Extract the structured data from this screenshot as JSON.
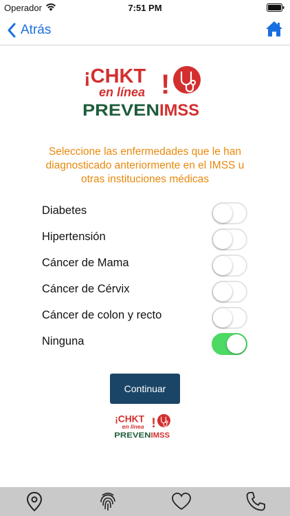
{
  "status_bar": {
    "carrier": "Operador",
    "time": "7:51 PM"
  },
  "nav": {
    "back_label": "Atrás"
  },
  "logo": {
    "line1": "¡CHKT",
    "line2": "en línea",
    "exclamation": "!",
    "brand_prefix": "PREVEN",
    "brand_suffix": "IMSS"
  },
  "instruction": "Seleccione las enfermedades que le han diagnosticado anteriormente en el IMSS u otras instituciones médicas",
  "diseases": [
    {
      "label": "Diabetes",
      "checked": false
    },
    {
      "label": "Hipertensión",
      "checked": false
    },
    {
      "label": "Cáncer de Mama",
      "checked": false
    },
    {
      "label": "Cáncer de Cérvix",
      "checked": false
    },
    {
      "label": "Cáncer de colon y recto",
      "checked": false
    },
    {
      "label": "Ninguna",
      "checked": true
    }
  ],
  "continue_label": "Continuar",
  "tabs": [
    {
      "icon": "location-pin-icon"
    },
    {
      "icon": "fingerprint-icon"
    },
    {
      "icon": "heart-icon"
    },
    {
      "icon": "phone-icon"
    }
  ],
  "colors": {
    "accent_blue": "#1a6fe0",
    "instruction_orange": "#e8890d",
    "brand_red": "#d32f2f",
    "brand_green": "#1f5c3a",
    "toggle_on": "#4cd964",
    "button_navy": "#1b4566",
    "tab_bar": "#c9c9c9"
  }
}
